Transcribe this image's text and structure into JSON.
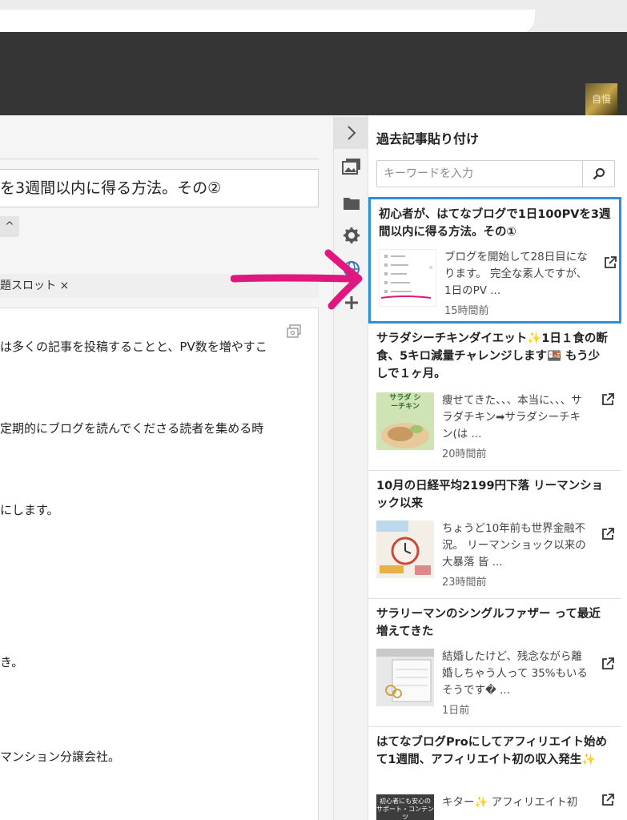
{
  "editor": {
    "title": "を3週間以内に得る方法。その②",
    "collapse_label": "^",
    "tag_text": "題スロット ×",
    "body_lines": [
      "は多くの記事を投稿することと、PV数を増やすこ",
      "定期的にブログを読んでくださる読者を集める時",
      "にします。",
      "き。",
      "マンション分譲会社。"
    ]
  },
  "toolbar": {
    "icons": [
      "chevron-right-icon",
      "image-icon",
      "folder-icon",
      "gear-icon",
      "globe-icon",
      "plus-icon"
    ]
  },
  "sidebar": {
    "title": "過去記事貼り付け",
    "search_placeholder": "キーワードを入力",
    "entries": [
      {
        "title": "初心者が、はてなブログで1日100PVを3週間以内に得る方法。その①",
        "excerpt": "ブログを開始して28日目になります。 完全な素人ですが、1日のPV ...",
        "time": "15時間前"
      },
      {
        "title": "サラダシーチキンダイエット✨1日１食の断食、5キロ減量チャレンジします🍱 もう少しで１ヶ月。",
        "excerpt": "痩せてきた、、、本当に、、、サラダチキン➡サラダシーチキン(は ...",
        "time": "20時間前",
        "thumb_text": "サラダ シーチキン"
      },
      {
        "title": "10月の日経平均2199円下落 リーマンショック以来",
        "excerpt": "ちょうど10年前も世界金融不況。 リーマンショック以来の大暴落 皆 ...",
        "time": "23時間前"
      },
      {
        "title": "サラリーマンのシングルファザー って最近増えてきた",
        "excerpt": "結婚したけど、残念ながら離婚しちゃう人って 35%もいるそうです� ...",
        "time": "1日前"
      },
      {
        "title": "はてなブログProにしてアフィリエイト始めて1週間、アフィリエイト初の収入発生✨",
        "excerpt": "キター✨ アフィリエイト初",
        "thumb_text": "初心者にも安心の サポート・コンテンツ"
      }
    ]
  },
  "avatar_text": "自慢",
  "colors": {
    "header": "#353535",
    "selected_border": "#2f8fd8",
    "arrow": "#e0177e"
  }
}
